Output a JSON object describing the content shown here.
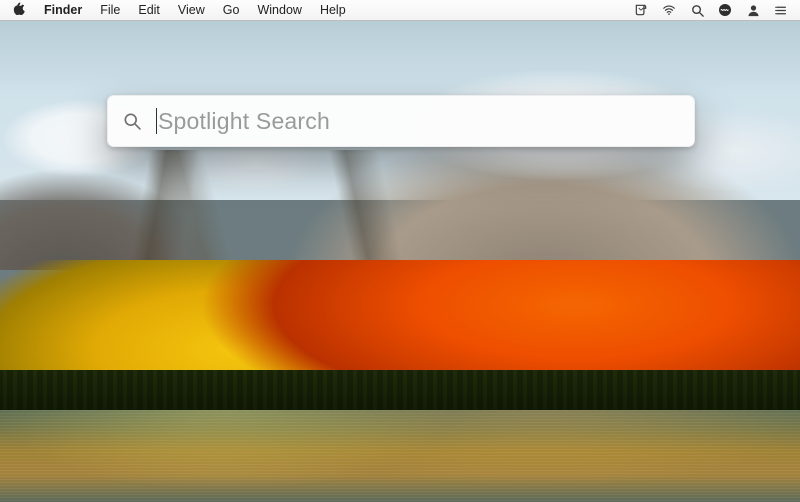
{
  "menubar": {
    "apple_icon": "apple-logo",
    "app_name": "Finder",
    "items": [
      "File",
      "Edit",
      "View",
      "Go",
      "Window",
      "Help"
    ],
    "status_icons": [
      "script-menu",
      "wifi",
      "spotlight",
      "siri",
      "user",
      "notification-center"
    ]
  },
  "spotlight": {
    "placeholder": "Spotlight Search",
    "value": ""
  },
  "wallpaper": {
    "name": "macOS High Sierra default"
  }
}
